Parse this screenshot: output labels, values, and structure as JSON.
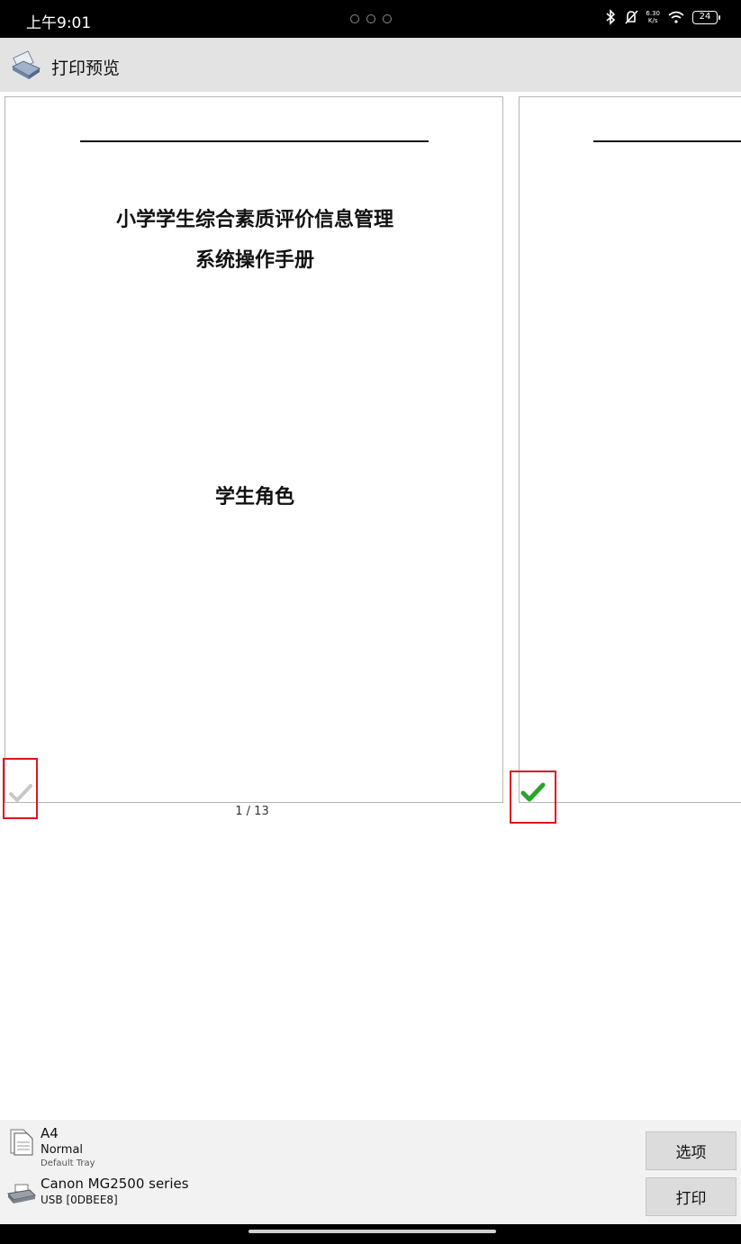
{
  "status_bar": {
    "time": "上午9:01",
    "net_speed_value": "6.30",
    "net_speed_unit": "K/s",
    "battery": "24"
  },
  "header": {
    "title": "打印预览"
  },
  "preview": {
    "page1": {
      "title_line1": "小学学生综合素质评价信息管理",
      "title_line2": "系统操作手册",
      "role": "学生角色"
    },
    "page_counter": "1 / 13",
    "page1_selected": false,
    "page2_selected": true,
    "colors": {
      "highlight_box": "#e0141e",
      "check_selected": "#2aa52a",
      "check_unselected": "#c8c8c8"
    }
  },
  "settings": {
    "paper_size": "A4",
    "paper_type": "Normal",
    "paper_tray": "Default Tray",
    "printer_name": "Canon MG2500 series",
    "printer_port": "USB [0DBEE8]"
  },
  "buttons": {
    "options": "选项",
    "print": "打印"
  },
  "icons": {
    "app": "printer-scanner-icon",
    "paper": "paper-document-icon",
    "printer": "printer-icon",
    "bluetooth": "bluetooth-icon",
    "mute": "bell-off-icon",
    "wifi": "wifi-icon",
    "check": "checkmark-icon"
  }
}
